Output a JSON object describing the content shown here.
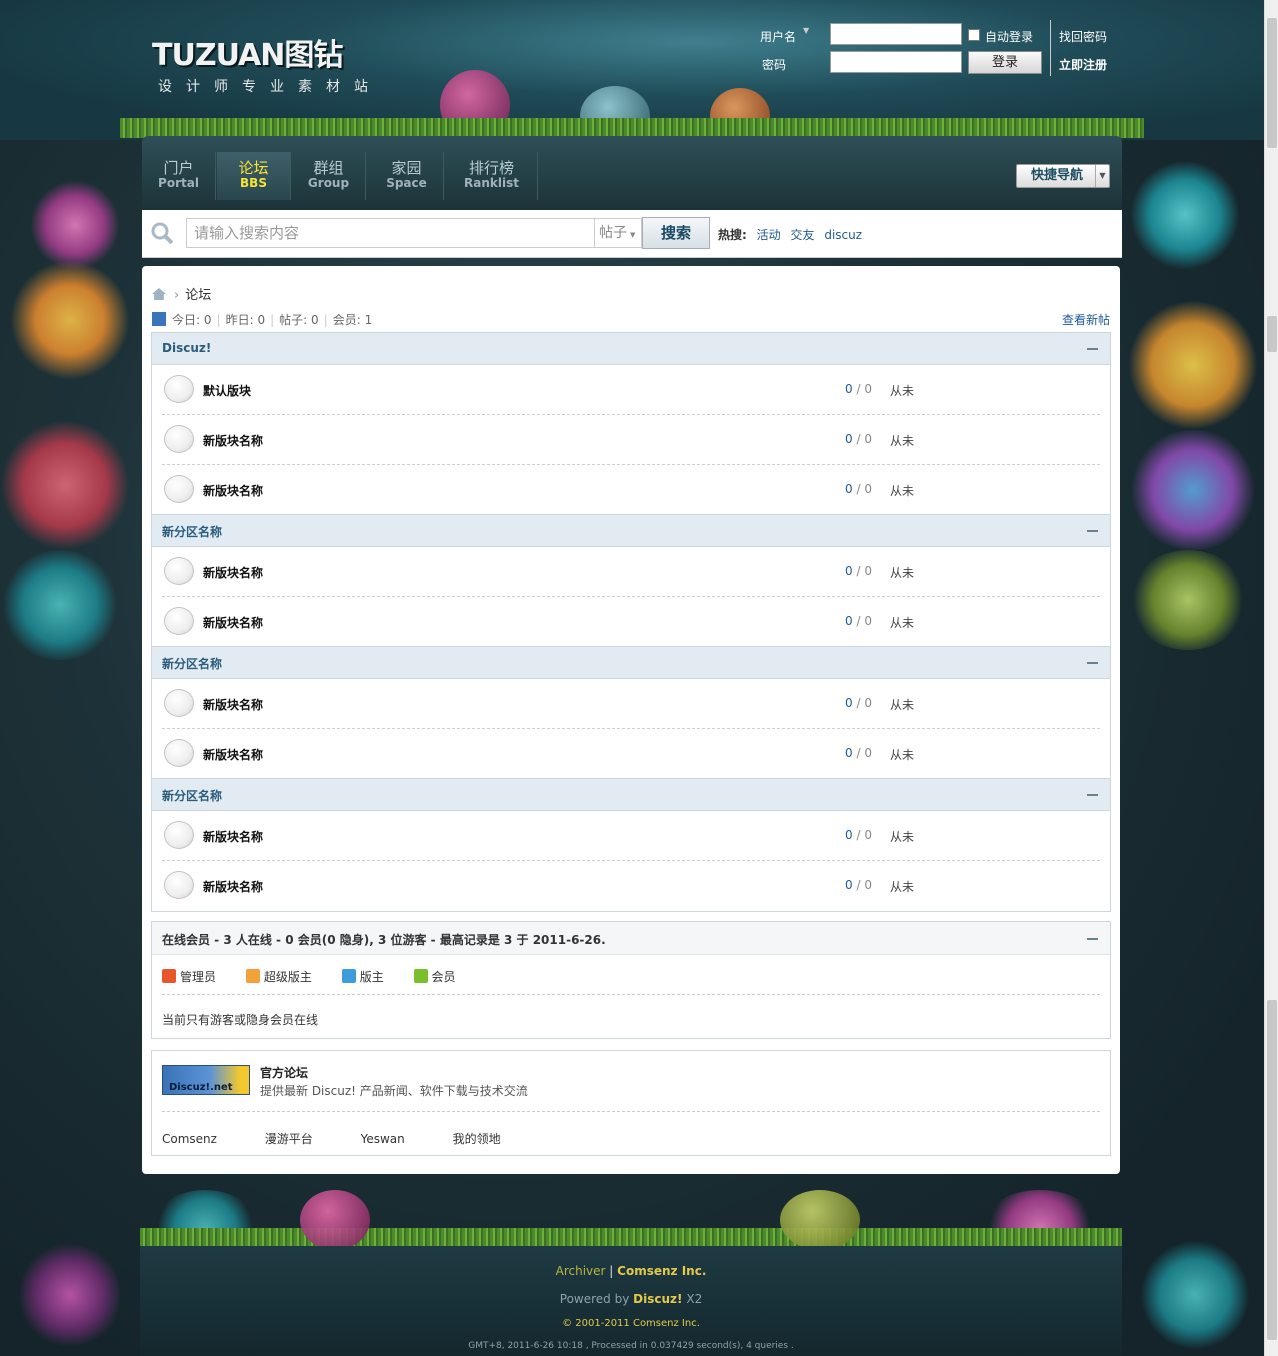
{
  "header": {
    "logo_main": "TUZUAN图钻",
    "logo_sub": "设计师专业素材站",
    "username_label": "用户名",
    "password_label": "密码",
    "auto_login_label": "自动登录",
    "login_button": "登录",
    "forgot_password": "找回密码",
    "register": "立即注册"
  },
  "nav": {
    "items": [
      {
        "cn": "门户",
        "en": "Portal"
      },
      {
        "cn": "论坛",
        "en": "BBS"
      },
      {
        "cn": "群组",
        "en": "Group"
      },
      {
        "cn": "家园",
        "en": "Space"
      },
      {
        "cn": "排行榜",
        "en": "Ranklist"
      }
    ],
    "quick_nav": "快捷导航"
  },
  "search": {
    "placeholder": "请输入搜索内容",
    "type": "帖子",
    "button": "搜索",
    "hot_label": "热搜:",
    "hot_terms": [
      "活动",
      "交友",
      "discuz"
    ]
  },
  "breadcrumb": {
    "current": "论坛"
  },
  "stats": {
    "today_label": "今日:",
    "today": "0",
    "yesterday_label": "昨日:",
    "yesterday": "0",
    "posts_label": "帖子:",
    "posts": "0",
    "members_label": "会员:",
    "members": "1",
    "new_posts_link": "查看新帖"
  },
  "categories": [
    {
      "title": "Discuz!",
      "forums": [
        {
          "name": "默认版块",
          "threads": "0",
          "posts": "0",
          "last": "从未"
        },
        {
          "name": "新版块名称",
          "threads": "0",
          "posts": "0",
          "last": "从未"
        },
        {
          "name": "新版块名称",
          "threads": "0",
          "posts": "0",
          "last": "从未"
        }
      ]
    },
    {
      "title": "新分区名称",
      "forums": [
        {
          "name": "新版块名称",
          "threads": "0",
          "posts": "0",
          "last": "从未"
        },
        {
          "name": "新版块名称",
          "threads": "0",
          "posts": "0",
          "last": "从未"
        }
      ]
    },
    {
      "title": "新分区名称",
      "forums": [
        {
          "name": "新版块名称",
          "threads": "0",
          "posts": "0",
          "last": "从未"
        },
        {
          "name": "新版块名称",
          "threads": "0",
          "posts": "0",
          "last": "从未"
        }
      ]
    },
    {
      "title": "新分区名称",
      "forums": [
        {
          "name": "新版块名称",
          "threads": "0",
          "posts": "0",
          "last": "从未"
        },
        {
          "name": "新版块名称",
          "threads": "0",
          "posts": "0",
          "last": "从未"
        }
      ]
    }
  ],
  "online": {
    "title": "在线会员 - 3 人在线 - 0 会员(0 隐身), 3 位游客 - 最高记录是 3 于 2011-6-26.",
    "legend": [
      {
        "label": "管理员",
        "color": "#e8562d"
      },
      {
        "label": "超级版主",
        "color": "#f0a33a"
      },
      {
        "label": "版主",
        "color": "#3d9be0"
      },
      {
        "label": "会员",
        "color": "#7bbf2c"
      }
    ],
    "message": "当前只有游客或隐身会员在线"
  },
  "links": {
    "logo_text": "Discuz!.net",
    "title": "官方论坛",
    "desc": "提供最新 Discuz! 产品新闻、软件下载与技术交流",
    "items": [
      "Comsenz",
      "漫游平台",
      "Yeswan",
      "我的领地"
    ]
  },
  "footer": {
    "archiver": "Archiver",
    "company": "Comsenz Inc.",
    "powered_by": "Powered by",
    "product": "Discuz!",
    "version": "X2",
    "copyright": "© 2001-2011 Comsenz Inc.",
    "debug": "GMT+8, 2011-6-26 10:18 , Processed in 0.037429 second(s), 4 queries ."
  }
}
